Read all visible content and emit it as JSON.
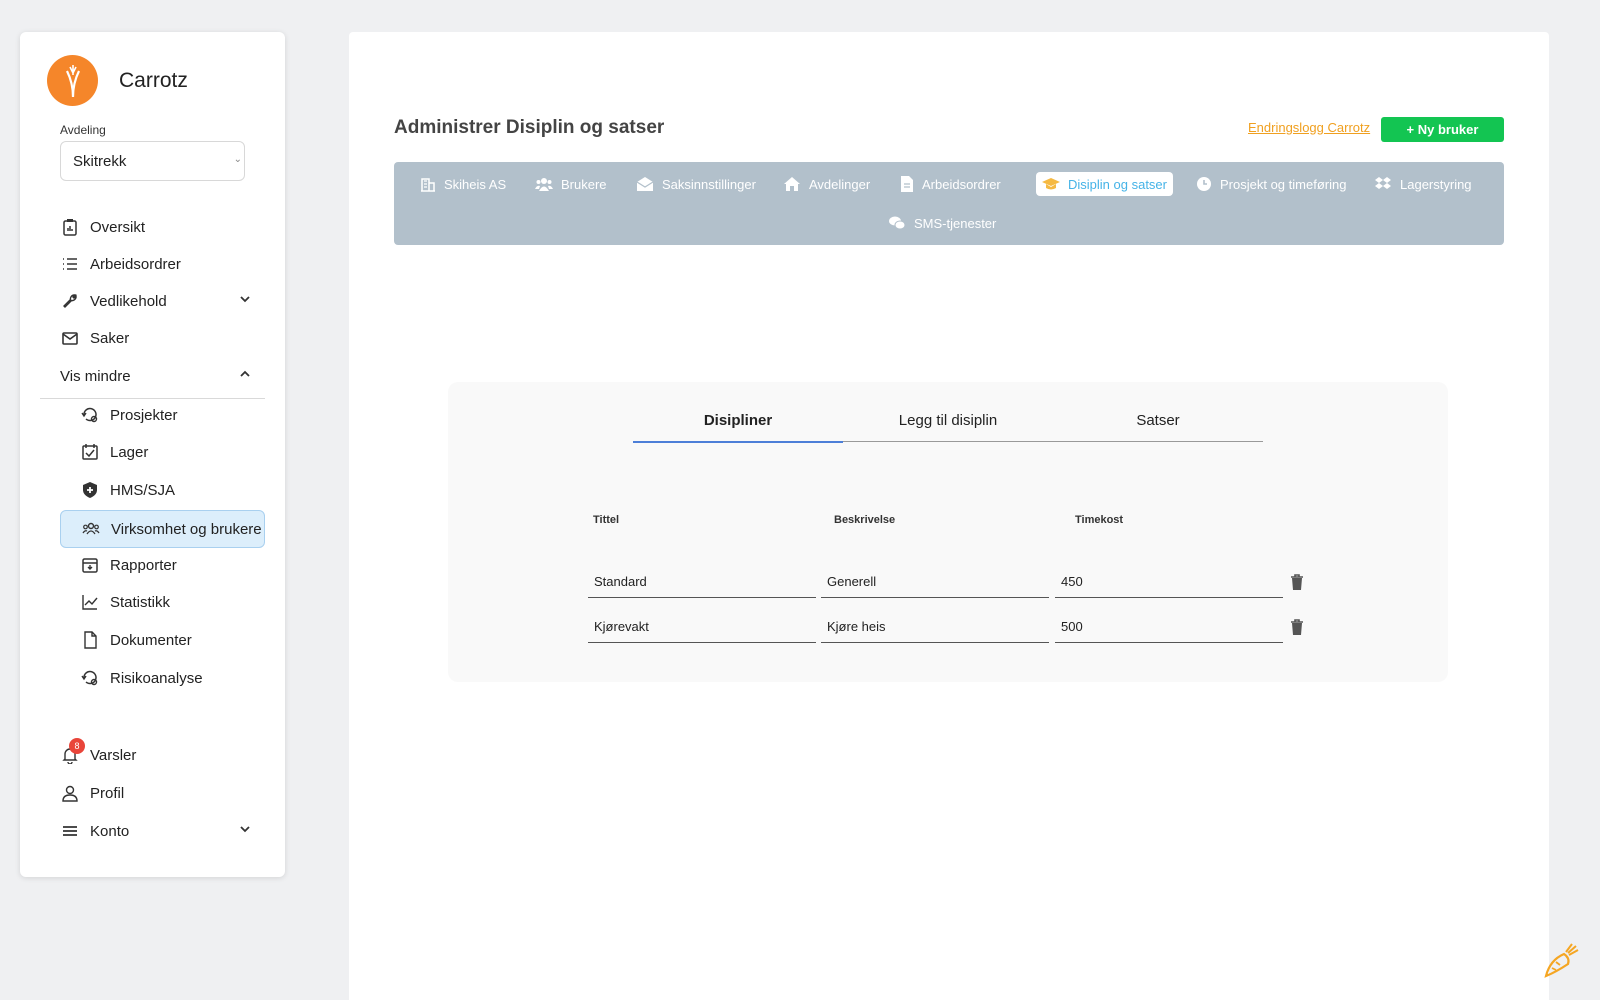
{
  "sidebar": {
    "brand": "Carrotz",
    "department_label": "Avdeling",
    "department_value": "Skitrekk",
    "items": [
      {
        "label": "Oversikt"
      },
      {
        "label": "Arbeidsordrer"
      },
      {
        "label": "Vedlikehold"
      },
      {
        "label": "Saker"
      },
      {
        "label": "Vis mindre"
      }
    ],
    "sub_items": [
      {
        "label": "Prosjekter"
      },
      {
        "label": "Lager"
      },
      {
        "label": "HMS/SJA"
      },
      {
        "label": "Virksomhet og brukere"
      },
      {
        "label": "Rapporter"
      },
      {
        "label": "Statistikk"
      },
      {
        "label": "Dokumenter"
      },
      {
        "label": "Risikoanalyse"
      }
    ],
    "bottom": [
      {
        "label": "Varsler",
        "badge": "8"
      },
      {
        "label": "Profil"
      },
      {
        "label": "Konto"
      }
    ]
  },
  "header": {
    "title": "Administrer Disiplin og satser",
    "changelog": "Endringslogg Carrotz",
    "new_user": "+ Ny bruker"
  },
  "tabs": [
    {
      "label": "Skiheis AS",
      "icon": "building-icon"
    },
    {
      "label": "Brukere",
      "icon": "users-icon"
    },
    {
      "label": "Saksinnstillinger",
      "icon": "envelope-open-icon"
    },
    {
      "label": "Avdelinger",
      "icon": "home-icon"
    },
    {
      "label": "Arbeidsordrer",
      "icon": "file-icon"
    },
    {
      "label": "Disiplin og satser",
      "icon": "graduation-cap-icon",
      "active": true
    },
    {
      "label": "Prosjekt og timeføring",
      "icon": "clock-icon"
    },
    {
      "label": "Lagerstyring",
      "icon": "dropbox-icon"
    },
    {
      "label": "SMS-tjenester",
      "icon": "chat-icon"
    }
  ],
  "card": {
    "tabs": [
      {
        "label": "Disipliner"
      },
      {
        "label": "Legg til disiplin"
      },
      {
        "label": "Satser"
      }
    ],
    "columns": [
      "Tittel",
      "Beskrivelse",
      "Timekost"
    ],
    "rows": [
      {
        "tittel": "Standard",
        "beskrivelse": "Generell",
        "timekost": "450"
      },
      {
        "tittel": "Kjørevakt",
        "beskrivelse": "Kjøre heis",
        "timekost": "500"
      }
    ]
  },
  "colors": {
    "brand_orange": "#f5862a",
    "accent_green": "#13c552",
    "tab_active_text": "#45b3e7",
    "tabbar_bg": "#b2c0cb",
    "badge_red": "#e9453a"
  }
}
